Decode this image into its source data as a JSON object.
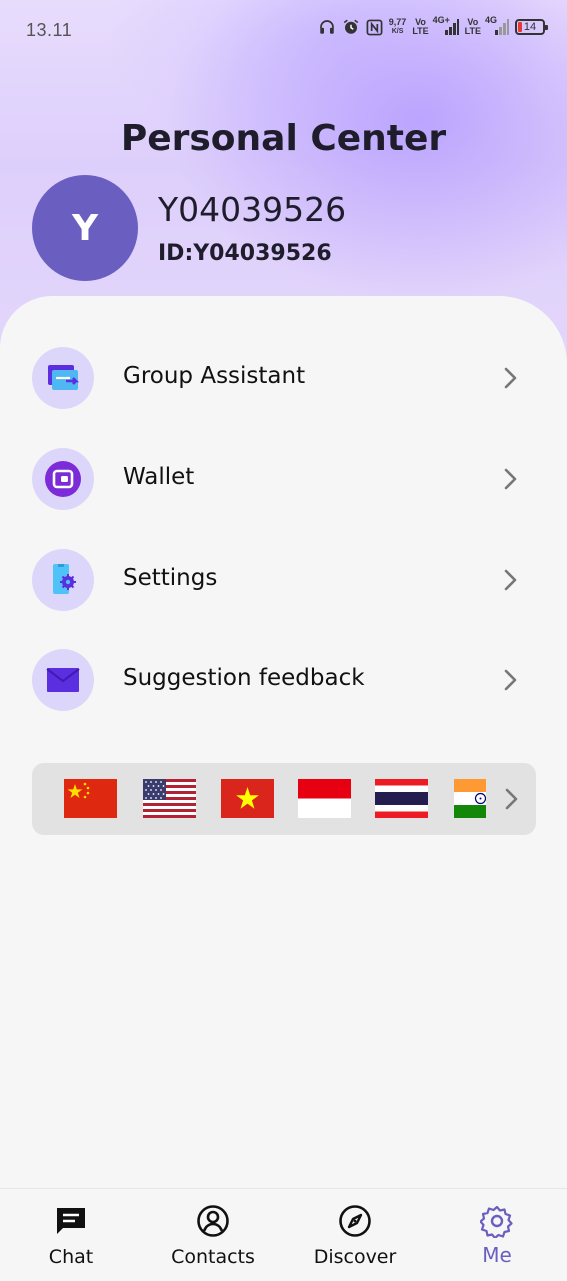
{
  "status_bar": {
    "time": "13.11",
    "net_speed_top": "9,77",
    "net_speed_bottom": "K/S",
    "volte1_top": "Vo",
    "volte1_bottom": "LTE",
    "sim1_type": "4G+",
    "volte2_top": "Vo",
    "volte2_bottom": "LTE",
    "sim2_type": "4G",
    "battery": "14",
    "battery_color": "#e53935"
  },
  "header": {
    "title": "Personal Center",
    "avatar_letter": "Y",
    "username": "Y04039526",
    "user_id": "ID:Y04039526"
  },
  "menu": {
    "items": [
      {
        "label": "Group Assistant",
        "icon": "group-assistant-icon"
      },
      {
        "label": "Wallet",
        "icon": "wallet-icon"
      },
      {
        "label": "Settings",
        "icon": "settings-phone-icon"
      },
      {
        "label": "Suggestion feedback",
        "icon": "envelope-icon"
      }
    ]
  },
  "languages": {
    "flags": [
      "china-flag",
      "usa-flag",
      "vietnam-flag",
      "indonesia-flag",
      "thailand-flag",
      "india-flag"
    ]
  },
  "tabbar": {
    "tabs": [
      {
        "label": "Chat",
        "icon": "chat-icon"
      },
      {
        "label": "Contacts",
        "icon": "contacts-icon"
      },
      {
        "label": "Discover",
        "icon": "compass-icon"
      },
      {
        "label": "Me",
        "icon": "gear-icon"
      }
    ],
    "active_index": 3
  },
  "colors": {
    "accent": "#6a5fc1",
    "icon_circle_bg": "#ddd6fb",
    "icon_purple": "#5b2ee0"
  }
}
